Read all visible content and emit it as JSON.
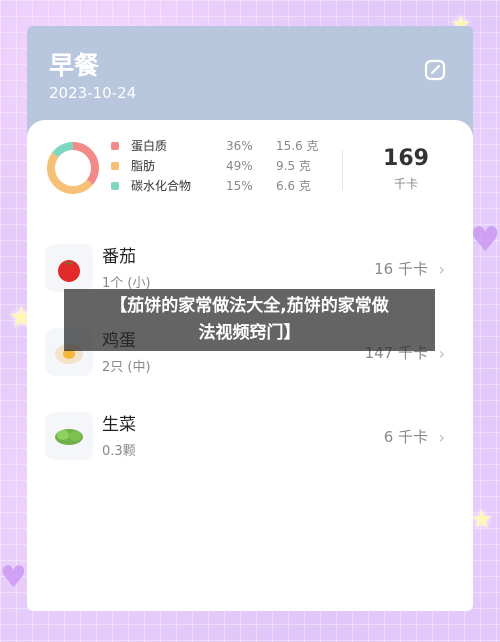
{
  "header": {
    "title": "早餐",
    "date": "2023-10-24"
  },
  "summary": {
    "macros": [
      {
        "name": "蛋白质",
        "percent": "36%",
        "amount": "15.6 克",
        "color": "#f28a8a"
      },
      {
        "name": "脂肪",
        "percent": "49%",
        "amount": "9.5 克",
        "color": "#f6c177"
      },
      {
        "name": "碳水化合物",
        "percent": "15%",
        "amount": "6.6 克",
        "color": "#7ed8c0"
      }
    ],
    "total_kcal": "169",
    "kcal_unit": "千卡"
  },
  "foods": [
    {
      "name": "番茄",
      "qty": "1个 (小)",
      "kcal": "16 千卡"
    },
    {
      "name": "鸡蛋",
      "qty": "2只 (中)",
      "kcal": "147 千卡"
    },
    {
      "name": "生菜",
      "qty": "0.3颗",
      "kcal": "6 千卡"
    }
  ],
  "banner": {
    "line1": "【茄饼的家常做法大全,茄饼的家常做",
    "line2": "法视频窍门】"
  }
}
